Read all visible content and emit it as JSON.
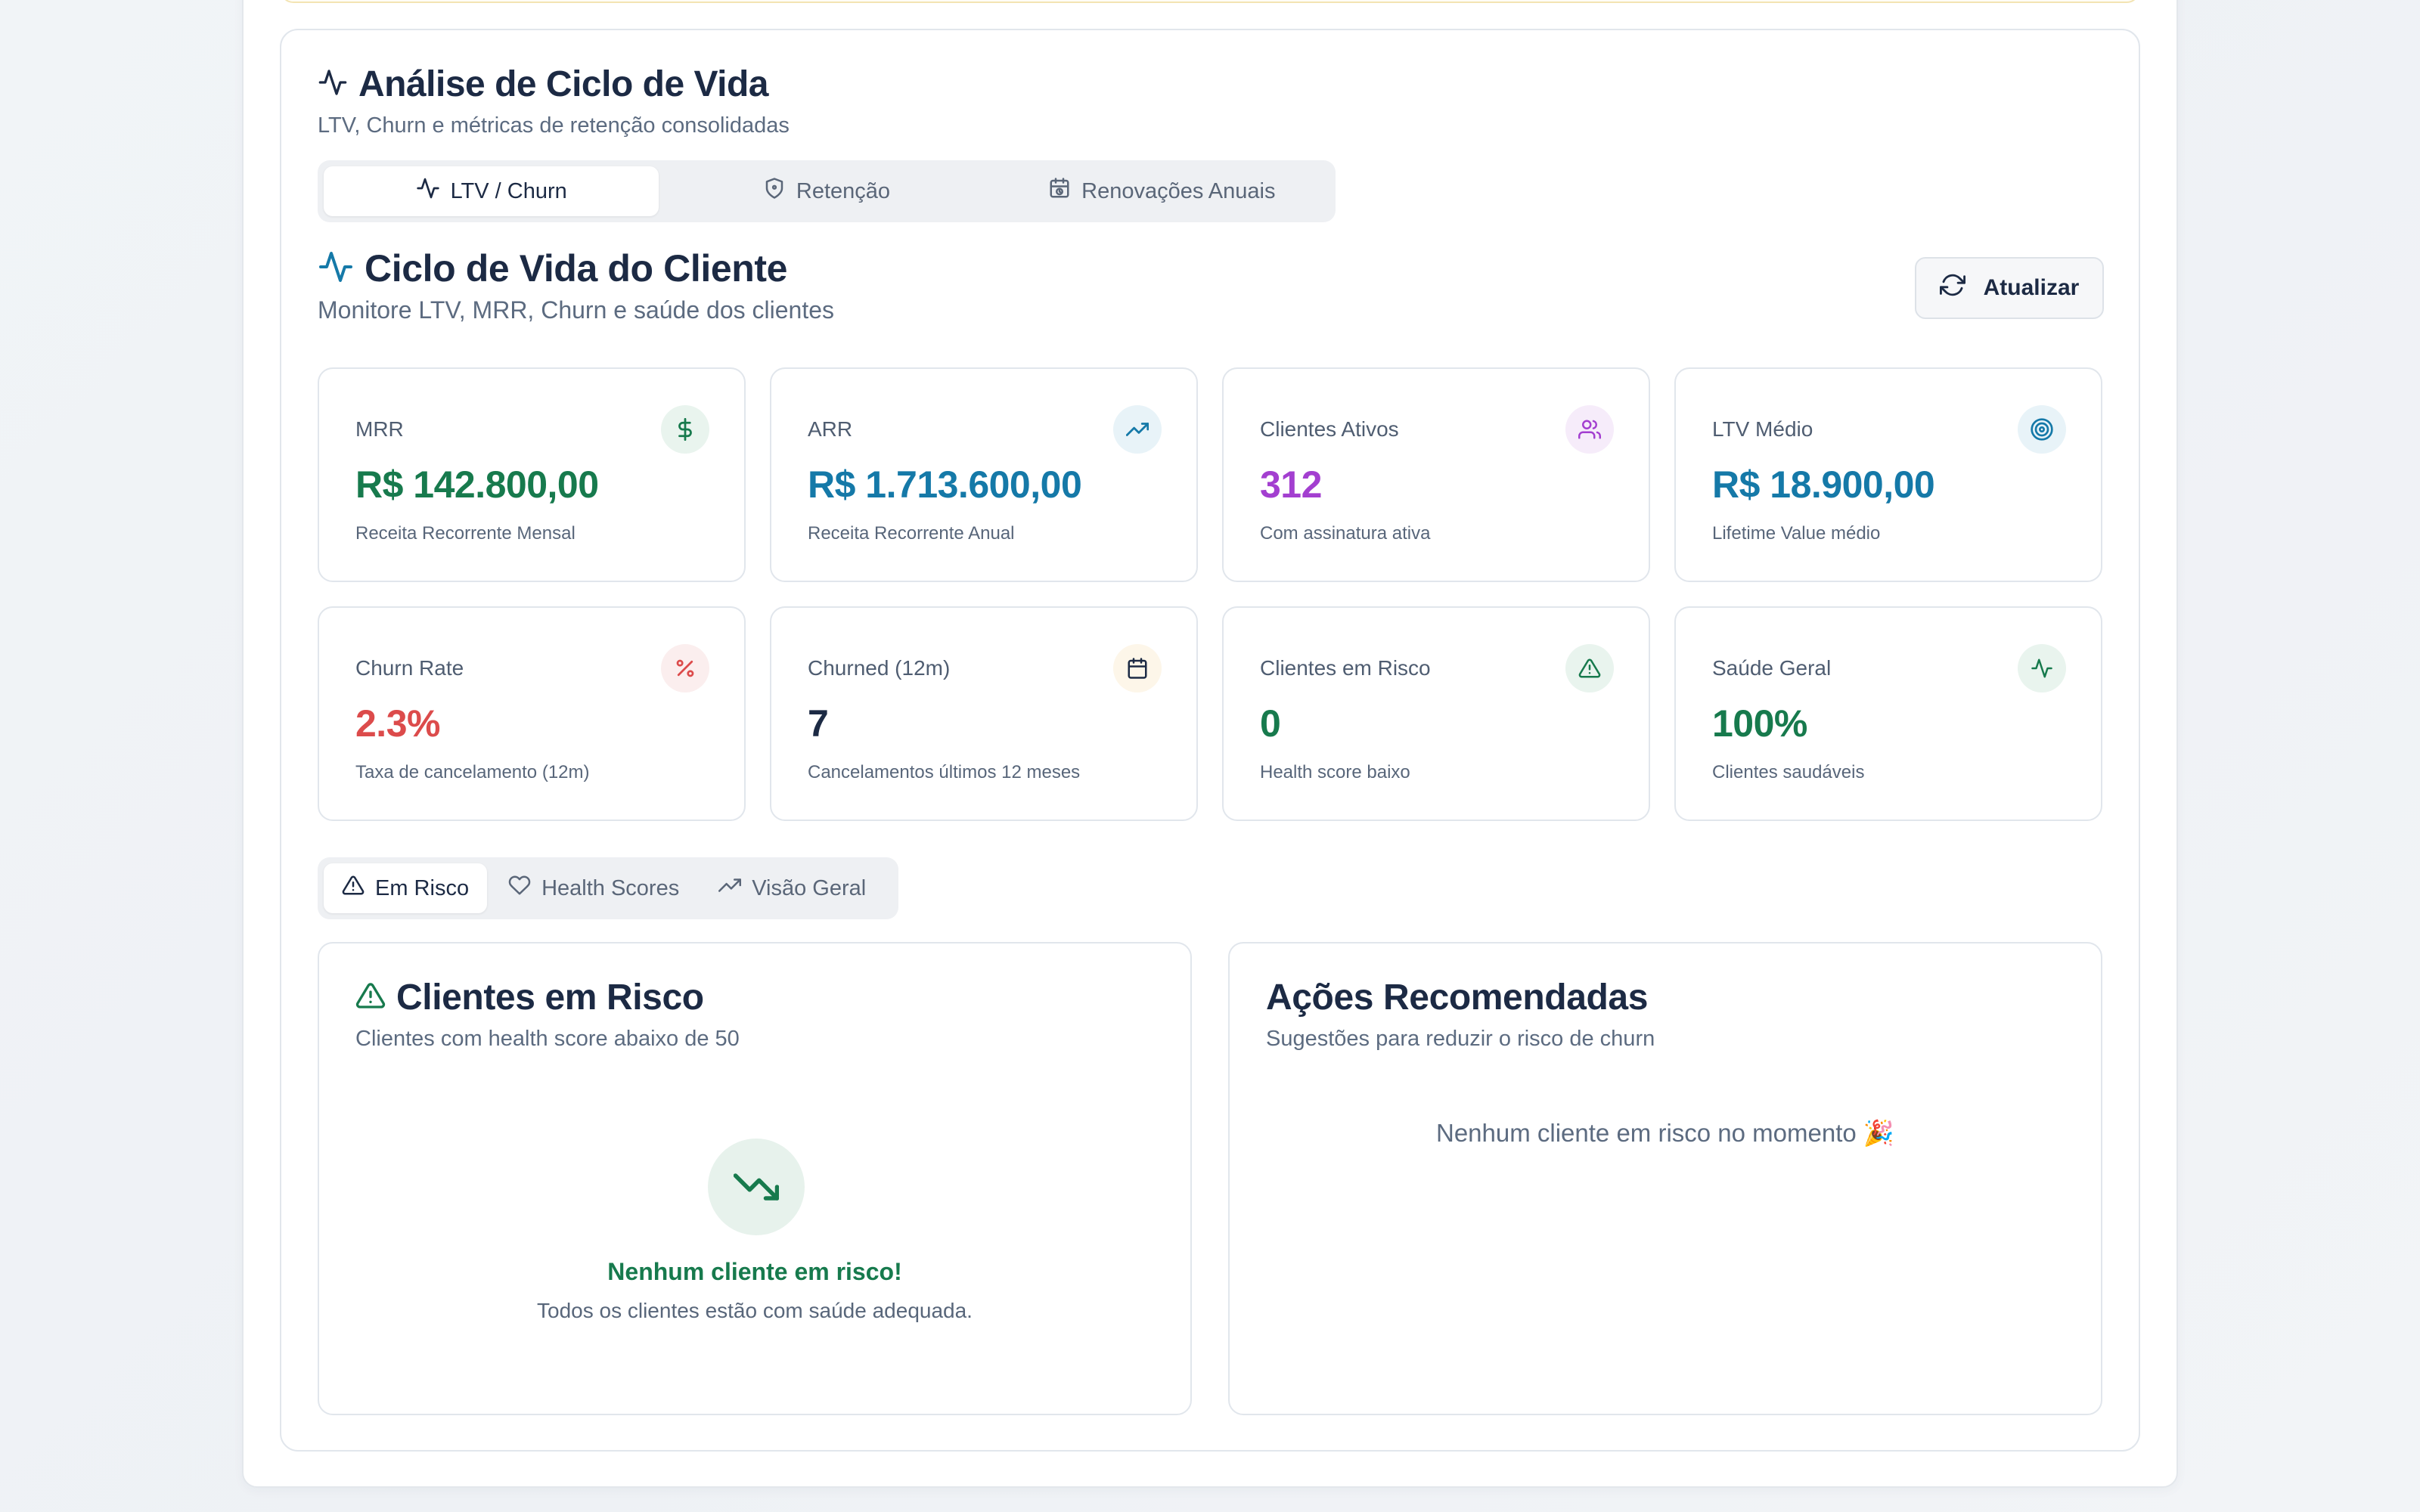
{
  "header": {
    "title": "Análise de Ciclo de Vida",
    "subtitle": "LTV, Churn e métricas de retenção consolidadas"
  },
  "main_tabs": [
    {
      "label": "LTV / Churn",
      "icon": "activity-icon",
      "active": true
    },
    {
      "label": "Retenção",
      "icon": "shield-icon",
      "active": false
    },
    {
      "label": "Renovações Anuais",
      "icon": "calendar-clock-icon",
      "active": false
    }
  ],
  "section": {
    "title": "Ciclo de Vida do Cliente",
    "subtitle": "Monitore LTV, MRR, Churn e saúde dos clientes",
    "refresh_label": "Atualizar"
  },
  "kpis": [
    {
      "label": "MRR",
      "value": "R$ 142.800,00",
      "desc": "Receita Recorrente Mensal",
      "icon": "dollar-icon",
      "color": "#177a4d",
      "bg": "#e9f4ee"
    },
    {
      "label": "ARR",
      "value": "R$ 1.713.600,00",
      "desc": "Receita Recorrente Anual",
      "icon": "trending-up-icon",
      "color": "#1579a8",
      "bg": "#e8f3f8"
    },
    {
      "label": "Clientes Ativos",
      "value": "312",
      "desc": "Com assinatura ativa",
      "icon": "users-icon",
      "color": "#a33fd0",
      "bg": "#f6ecfa"
    },
    {
      "label": "LTV Médio",
      "value": "R$ 18.900,00",
      "desc": "Lifetime Value médio",
      "icon": "target-icon",
      "color": "#1579a8",
      "bg": "#e8f3f8"
    },
    {
      "label": "Churn Rate",
      "value": "2.3%",
      "desc": "Taxa de cancelamento (12m)",
      "icon": "percent-icon",
      "color": "#dc4b4b",
      "bg": "#fbeeee"
    },
    {
      "label": "Churned (12m)",
      "value": "7",
      "desc": "Cancelamentos últimos 12 meses",
      "icon": "calendar-icon",
      "color": "#1c2a44",
      "bg": "#fdf6e9"
    },
    {
      "label": "Clientes em Risco",
      "value": "0",
      "desc": "Health score baixo",
      "icon": "alert-triangle-icon",
      "color": "#177a4d",
      "bg": "#e9f4ee"
    },
    {
      "label": "Saúde Geral",
      "value": "100%",
      "desc": "Clientes saudáveis",
      "icon": "activity-icon",
      "color": "#177a4d",
      "bg": "#e9f4ee"
    }
  ],
  "sub_tabs": [
    {
      "label": "Em Risco",
      "icon": "alert-triangle-icon",
      "active": true
    },
    {
      "label": "Health Scores",
      "icon": "heart-icon",
      "active": false
    },
    {
      "label": "Visão Geral",
      "icon": "trending-up-icon",
      "active": false
    }
  ],
  "risk_panel": {
    "title": "Clientes em Risco",
    "subtitle": "Clientes com health score abaixo de 50",
    "empty_title": "Nenhum cliente em risco!",
    "empty_desc": "Todos os clientes estão com saúde adequada."
  },
  "actions_panel": {
    "title": "Ações Recomendadas",
    "subtitle": "Sugestões para reduzir o risco de churn",
    "empty_msg": "Nenhum cliente em risco no momento 🎉"
  }
}
